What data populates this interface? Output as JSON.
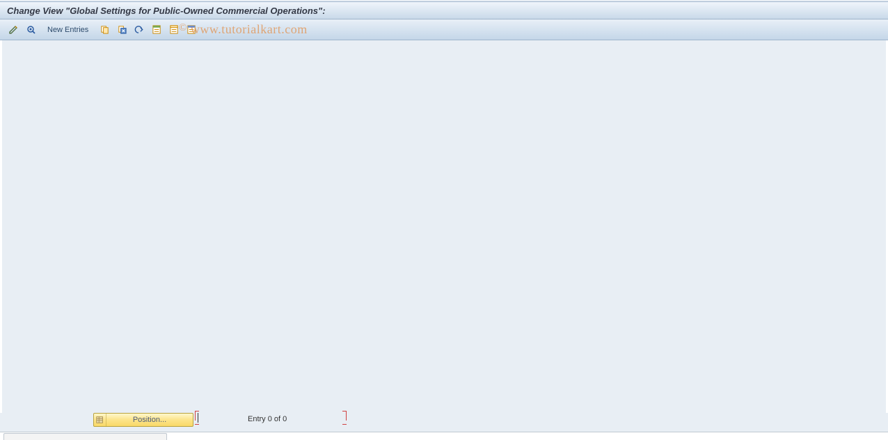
{
  "header": {
    "title": "Change View \"Global Settings for Public-Owned Commercial Operations\":"
  },
  "toolbar": {
    "new_entries_label": "New Entries"
  },
  "watermark": {
    "text": "www.tutorialkart.com",
    "copyright": "©"
  },
  "footer": {
    "position_label": "Position...",
    "entry_text": "Entry 0 of 0"
  }
}
